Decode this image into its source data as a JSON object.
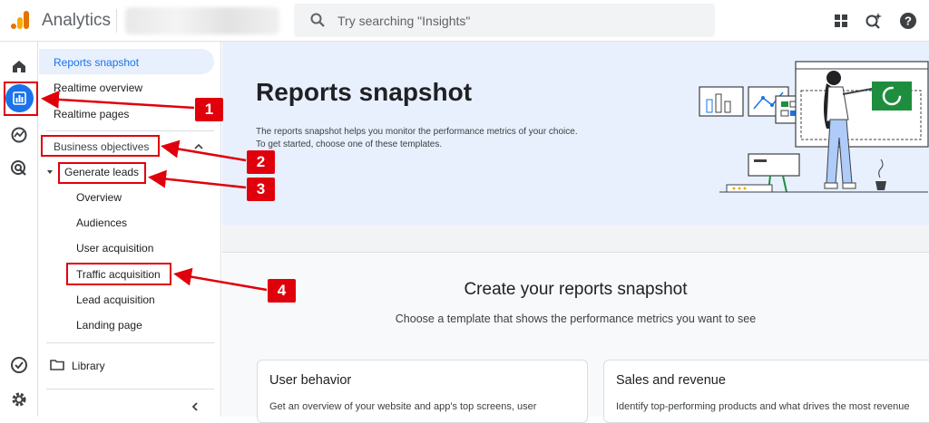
{
  "header": {
    "app_title": "Analytics",
    "search_placeholder": "Try searching \"Insights\"",
    "icons": [
      "apps-grid-icon",
      "insights-sparkle-icon",
      "help-icon"
    ]
  },
  "rail": {
    "icons": [
      "home-icon",
      "reports-icon",
      "explore-icon",
      "advertising-icon",
      "admin-check-icon",
      "settings-gear-icon"
    ]
  },
  "nav": {
    "items": {
      "reports_snapshot": "Reports snapshot",
      "realtime_overview": "Realtime overview",
      "realtime_pages": "Realtime pages",
      "business_objectives": "Business objectives",
      "generate_leads": "Generate leads",
      "overview": "Overview",
      "audiences": "Audiences",
      "user_acquisition": "User acquisition",
      "traffic_acquisition": "Traffic acquisition",
      "lead_acquisition": "Lead acquisition",
      "landing_page": "Landing page",
      "library": "Library"
    }
  },
  "hero": {
    "title": "Reports snapshot",
    "desc_line1": "The reports snapshot helps you monitor the performance metrics of your choice.",
    "desc_line2": "To get started, choose one of these templates."
  },
  "panel": {
    "title": "Create your reports snapshot",
    "subtitle": "Choose a template that shows the performance metrics you want to see",
    "cards": [
      {
        "title": "User behavior",
        "desc": "Get an overview of your website and app's top screens, user"
      },
      {
        "title": "Sales and revenue",
        "desc": "Identify top-performing products and what drives the most revenue"
      }
    ]
  },
  "annotations": {
    "badges": [
      "1",
      "2",
      "3",
      "4"
    ]
  },
  "colors": {
    "accent": "#1a73e8",
    "annotation_red": "#e0000b",
    "hero_bg": "#e8f0fe"
  }
}
